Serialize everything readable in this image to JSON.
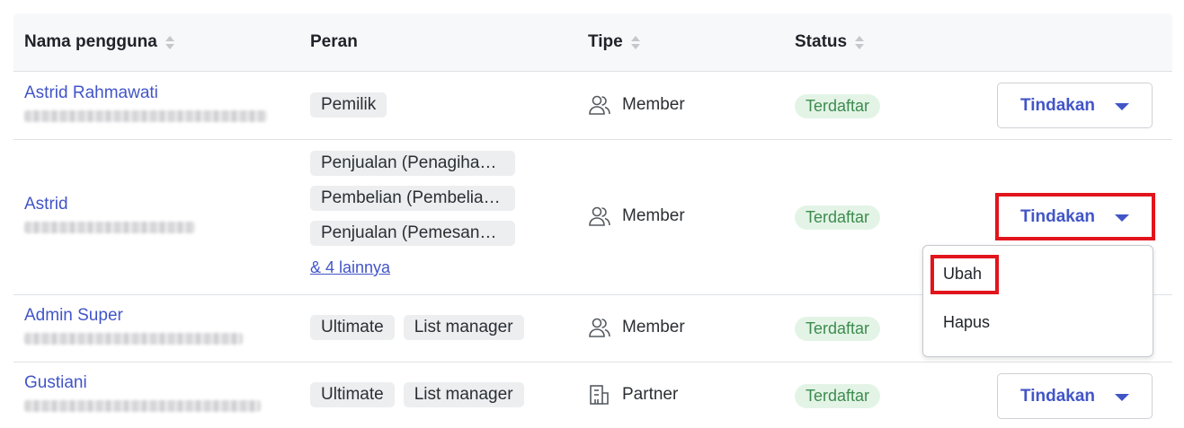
{
  "table": {
    "headers": {
      "username": "Nama pengguna",
      "role": "Peran",
      "type": "Tipe",
      "status": "Status"
    },
    "rows": [
      {
        "name": "Astrid Rahmawati",
        "roles": [
          "Pemilik"
        ],
        "type": "Member",
        "type_icon": "users-icon",
        "status": "Terdaftar",
        "action": "Tindakan"
      },
      {
        "name": "Astrid",
        "roles": [
          "Penjualan (Penagiha…",
          "Pembelian (Pembelia…",
          "Penjualan (Pemesan…"
        ],
        "more_roles": "& 4 lainnya",
        "type": "Member",
        "type_icon": "users-icon",
        "status": "Terdaftar",
        "action": "Tindakan"
      },
      {
        "name": "Admin Super",
        "roles": [
          "Ultimate",
          "List manager"
        ],
        "type": "Member",
        "type_icon": "users-icon",
        "status": "Terdaftar"
      },
      {
        "name": "Gustiani",
        "roles": [
          "Ultimate",
          "List manager"
        ],
        "type": "Partner",
        "type_icon": "building-icon",
        "status": "Terdaftar",
        "action": "Tindakan"
      }
    ]
  },
  "dropdown": {
    "items": [
      "Ubah",
      "Hapus"
    ]
  },
  "colors": {
    "link": "#4255c7",
    "status_bg": "#e3f4e6",
    "status_text": "#3d8b4f",
    "highlight": "#e2141c",
    "header_bg": "#f7f8f9"
  }
}
